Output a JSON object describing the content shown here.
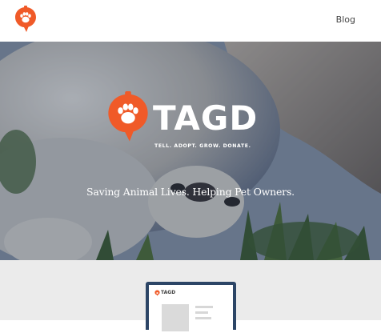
{
  "header": {
    "logo": {
      "icon": "paw-speech-bubble-icon",
      "color": "#f05a28"
    },
    "nav": {
      "blog_label": "Blog"
    }
  },
  "hero": {
    "brand_name": "TAGD",
    "tagline": "TELL. ADOPT. GROW. DONATE.",
    "headline": "Saving Animal Lives. Helping Pet Owners.",
    "background": "dog-and-cat-cuddling-on-grass-photo",
    "overlay_color": "#162e54"
  },
  "preview": {
    "brand_name": "TAGD",
    "frame_color": "#2c4566",
    "section_background": "#ebebeb"
  },
  "colors": {
    "accent": "#f05a28",
    "text_dark": "#444444",
    "white": "#ffffff"
  }
}
